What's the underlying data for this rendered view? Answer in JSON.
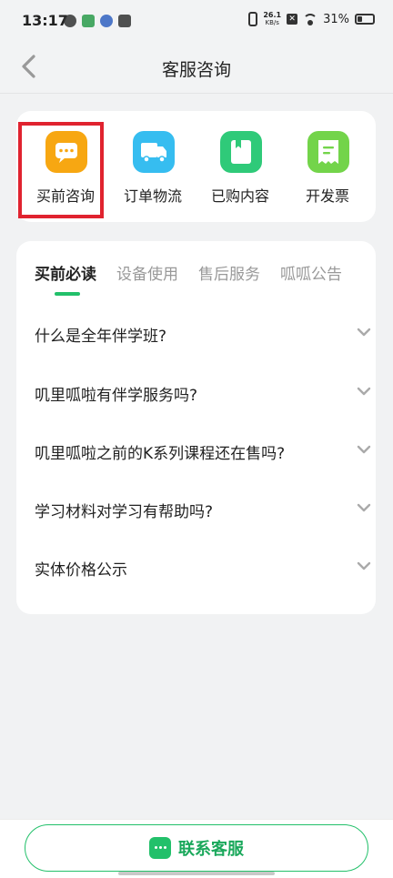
{
  "status_bar": {
    "time": "13:17",
    "net_speed_value": "26.1",
    "net_speed_unit": "KB/s",
    "battery_percent": "31%",
    "battery_level": 0.31
  },
  "header": {
    "title": "客服咨询"
  },
  "quick_actions": [
    {
      "label": "买前咨询",
      "icon": "chat-bubble-icon",
      "color": "#f7a712"
    },
    {
      "label": "订单物流",
      "icon": "truck-icon",
      "color": "#36bdf0"
    },
    {
      "label": "已购内容",
      "icon": "book-icon",
      "color": "#2fca79"
    },
    {
      "label": "开发票",
      "icon": "receipt-icon",
      "color": "#73d44a"
    }
  ],
  "tabs": [
    {
      "label": "买前必读",
      "active": true
    },
    {
      "label": "设备使用",
      "active": false
    },
    {
      "label": "售后服务",
      "active": false
    },
    {
      "label": "呱呱公告",
      "active": false
    }
  ],
  "faq": [
    {
      "question": "什么是全年伴学班?"
    },
    {
      "question": "叽里呱啦有伴学服务吗?"
    },
    {
      "question": "叽里呱啦之前的K系列课程还在售吗?"
    },
    {
      "question": "学习材料对学习有帮助吗?"
    },
    {
      "question": "实体价格公示"
    }
  ],
  "contact": {
    "label": "联系客服"
  },
  "colors": {
    "accent": "#22c06a",
    "highlight": "#e0232f"
  }
}
